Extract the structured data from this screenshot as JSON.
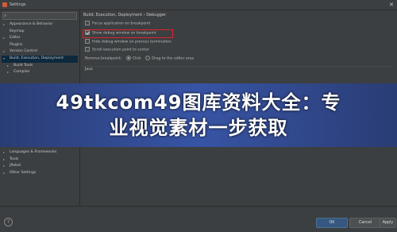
{
  "window": {
    "title": "Settings"
  },
  "sidebar": {
    "items": [
      {
        "label": "Appearance & Behavior",
        "arrow": "▸"
      },
      {
        "label": "Keymap",
        "arrow": ""
      },
      {
        "label": "Editor",
        "arrow": "▸"
      },
      {
        "label": "Plugins",
        "arrow": ""
      },
      {
        "label": "Version Control",
        "arrow": "▸"
      },
      {
        "label": "Build, Execution, Deployment",
        "arrow": "▾"
      },
      {
        "label": "Build Tools",
        "arrow": "▸"
      },
      {
        "label": "Compiler",
        "arrow": "▸"
      }
    ],
    "items_lower": [
      {
        "label": "Languages & Frameworks",
        "arrow": "▸"
      },
      {
        "label": "Tools",
        "arrow": "▸"
      },
      {
        "label": "JRebel",
        "arrow": "▸"
      },
      {
        "label": "Other Settings",
        "arrow": "▸"
      }
    ]
  },
  "main": {
    "breadcrumb": "Build, Execution, Deployment › Debugger",
    "options": [
      {
        "label": "Focus application on breakpoint",
        "checked": false
      },
      {
        "label": "Show debug window on breakpoint",
        "checked": true
      },
      {
        "label": "Hide debug window on process termination",
        "checked": false
      },
      {
        "label": "Scroll execution point to center",
        "checked": false
      }
    ],
    "remove_breakpoint": {
      "label": "Remove breakpoint:",
      "opt1": "Click",
      "opt2": "Drag to the editor area"
    },
    "java_section": "Java"
  },
  "banner": {
    "line1": "49tkcom49图库资料大全：专",
    "line2": "业视觉素材一步获取"
  },
  "buttons": {
    "ok": "OK",
    "cancel": "Cancel",
    "apply": "Apply"
  },
  "help": "?"
}
